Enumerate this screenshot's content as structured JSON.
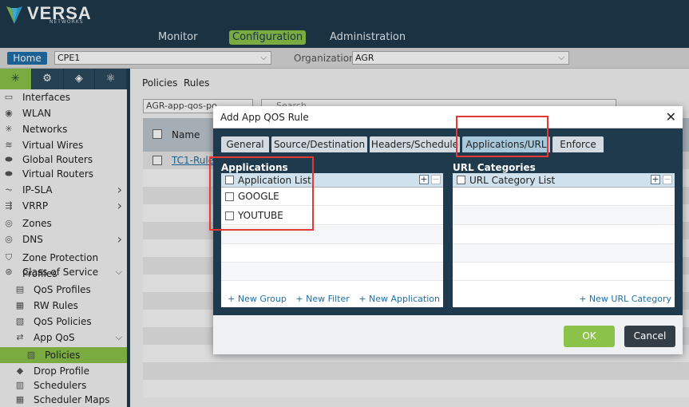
{
  "brand": {
    "name": "VERSA",
    "sub": "NETWORKS"
  },
  "nav": [
    {
      "label": "Monitor",
      "active": false
    },
    {
      "label": "Configuration",
      "active": true
    },
    {
      "label": "Administration",
      "active": false
    }
  ],
  "subbar": {
    "home_label": "Home",
    "device_value": "CPE1",
    "org_label": "Organization:",
    "org_value": "AGR"
  },
  "sidebar": {
    "tabs": [
      "network-icon",
      "gear-icon",
      "cube-icon",
      "settings-icon"
    ],
    "items": [
      {
        "label": "Interfaces",
        "icon": "interface-icon"
      },
      {
        "label": "WLAN",
        "icon": "wifi-icon"
      },
      {
        "label": "Networks",
        "icon": "network-icon"
      },
      {
        "label": "Virtual Wires",
        "icon": "wire-icon"
      },
      {
        "label": "Global Routers",
        "icon": "router-icon"
      },
      {
        "label": "Virtual Routers",
        "icon": "router-icon"
      },
      {
        "label": "IP-SLA",
        "icon": "chart-icon",
        "arrow": true
      },
      {
        "label": "VRRP",
        "icon": "vrrp-icon",
        "arrow": true
      },
      {
        "label": "Zones",
        "icon": "zone-icon"
      },
      {
        "label": "DNS",
        "icon": "dns-icon",
        "arrow": true
      },
      {
        "label": "Zone Protection Profiles",
        "icon": "shield-icon"
      },
      {
        "label": "Class of Service",
        "icon": "cos-icon",
        "expanded": true
      },
      {
        "label": "QoS Profiles",
        "icon": "profile-icon",
        "indent": 1
      },
      {
        "label": "RW Rules",
        "icon": "rules-icon",
        "indent": 1
      },
      {
        "label": "QoS Policies",
        "icon": "policy-icon",
        "indent": 1
      },
      {
        "label": "App QoS",
        "icon": "appqos-icon",
        "indent": 1,
        "expanded": true
      },
      {
        "label": "Policies",
        "icon": "policy-icon",
        "indent": 2,
        "selected": true
      },
      {
        "label": "Drop Profile",
        "icon": "drop-icon",
        "indent": 1
      },
      {
        "label": "Schedulers",
        "icon": "scheduler-icon",
        "indent": 1
      },
      {
        "label": "Scheduler Maps",
        "icon": "map-icon",
        "indent": 1
      }
    ]
  },
  "main": {
    "crumbs": [
      "Policies",
      "Rules"
    ],
    "filter_value": "AGR-app-qos-po",
    "search_placeholder": "Search",
    "col_name": "Name",
    "row_link": "TC1-Rule"
  },
  "modal": {
    "title": "Add App QOS Rule",
    "tabs": [
      {
        "label": "General",
        "active": false
      },
      {
        "label": "Source/Destination",
        "active": false
      },
      {
        "label": "Headers/Schedule",
        "active": false
      },
      {
        "label": "Applications/URL",
        "active": true
      },
      {
        "label": "Enforce",
        "active": false
      }
    ],
    "applications": {
      "section_label": "Applications",
      "header": "Application List",
      "rows": [
        "GOOGLE",
        "YOUTUBE"
      ],
      "footer": [
        "+ New Group",
        "+ New Filter",
        "+ New Application"
      ]
    },
    "url_categories": {
      "section_label": "URL Categories",
      "header": "URL Category List",
      "footer": [
        "+ New URL Category"
      ]
    },
    "ok_label": "OK",
    "cancel_label": "Cancel"
  },
  "colors": {
    "header_bg": "#1f3a4d",
    "accent": "#8bc34a",
    "link": "#1f6fa8",
    "annotation": "#e53935"
  }
}
